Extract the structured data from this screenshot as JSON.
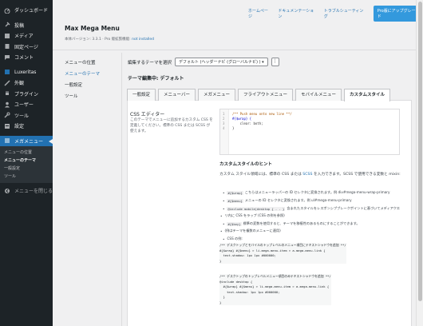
{
  "sidebar": {
    "items": [
      {
        "label": "ダッシュボード",
        "icon": "dashboard-icon"
      },
      {
        "label": "投稿",
        "icon": "pin-icon"
      },
      {
        "label": "メディア",
        "icon": "media-icon"
      },
      {
        "label": "固定ページ",
        "icon": "page-icon"
      },
      {
        "label": "コメント",
        "icon": "comment-icon"
      },
      {
        "label": "Luxeritas",
        "icon": "luxeritas-icon"
      },
      {
        "label": "外観",
        "icon": "brush-icon"
      },
      {
        "label": "プラグイン",
        "icon": "plugin-icon"
      },
      {
        "label": "ユーザー",
        "icon": "user-icon"
      },
      {
        "label": "ツール",
        "icon": "wrench-icon"
      },
      {
        "label": "設定",
        "icon": "settings-icon"
      },
      {
        "label": "メガメニュー",
        "icon": "megamenu-icon"
      }
    ],
    "sub_items": [
      "メニューの位置",
      "メニューのテーマ",
      "一般設定",
      "ツール"
    ],
    "collapse_label": "メニューを閉じる"
  },
  "toplinks": {
    "home": "ホームページ",
    "docs": "ドキュメンテーション",
    "trouble": "トラブルシューティング",
    "upgrade": "Pro版にアップグレード"
  },
  "header": {
    "title": "Max Mega Menu",
    "version": "本体バージョン: 3.3.1 · Pro 版拡張機能: ",
    "not_installed": "not installed"
  },
  "settings_nav": [
    "メニューの位置",
    "メニューのテーマ",
    "一般設定",
    "ツール"
  ],
  "theme_select": {
    "label": "編集するテーマを選択",
    "value": "デフォルト (ヘッダーナビ (グローバルナビ) ) ▾",
    "more": "⋮"
  },
  "editing": "テーマ編集中: デフォルト",
  "tabs": [
    "一般設定",
    "メニューバー",
    "メガメニュー",
    "フライアウトメニュー",
    "モバイルメニュー",
    "カスタムスタイル"
  ],
  "css_editor": {
    "label": "CSS エディター",
    "desc": "このテーマでメニューに追加するカスタム CSS を定義してください。標準の CSS または SCSS が使えます。",
    "lines": [
      "/** Push menu onto new line **/",
      "#{$wrap} {",
      "    clear: both;",
      "}"
    ]
  },
  "hints": {
    "heading": "カスタムスタイルのヒント",
    "intro_a": "カスタム スタイル領域には、標準の CSS または ",
    "intro_link": "SCSS",
    "intro_b": " を入力できます。SCSS で使用できる変数と mixin:",
    "bullets": [
      {
        "code": "#{$wrap}",
        "text": "こちらはメニューラッパーの ID セレクタに変換されます。例 div#mega-menu-wrap-primary"
      },
      {
        "code": "#{$menu}",
        "text": "メニューの ID セレクタに変換されます。例 ul#mega-menu-primary"
      },
      {
        "code": "@include mobile|desktop { . . }",
        "text": "含まれたスタイルをレスポンシブブレークポイントに基づいてメディアクエ"
      },
      {
        "code": "",
        "text": "リ内に CSS をラップ (CSS の例を参照)"
      },
      {
        "code": "#{$key}",
        "text": "標準の変数を使用すると、テーマを移植性のあるものにすることができます。"
      },
      {
        "code": "",
        "text": "(例はテーマを複数のメニューに適用)"
      },
      {
        "code": "",
        "text": "CSS の例:"
      }
    ],
    "code1": [
      "/** デスクトップとモバイルのトップレベルのメニュー項目にテキストシャドウを追加 **/",
      "#{$wrap} #{$menu} > li.mega-menu-item > a.mega-menu-link {",
      "  text-shadow: 1px 1px #000000;",
      "}"
    ],
    "code2": [
      "/** デスクトップのトップレベルメニュー項目のみテキストシャドウを追加 **/",
      "@include desktop {",
      "  #{$wrap} #{$menu} > li.mega-menu-item > a.mega-menu-link {",
      "    text-shadow: 1px 1px #000000;",
      "  }",
      "}"
    ]
  }
}
